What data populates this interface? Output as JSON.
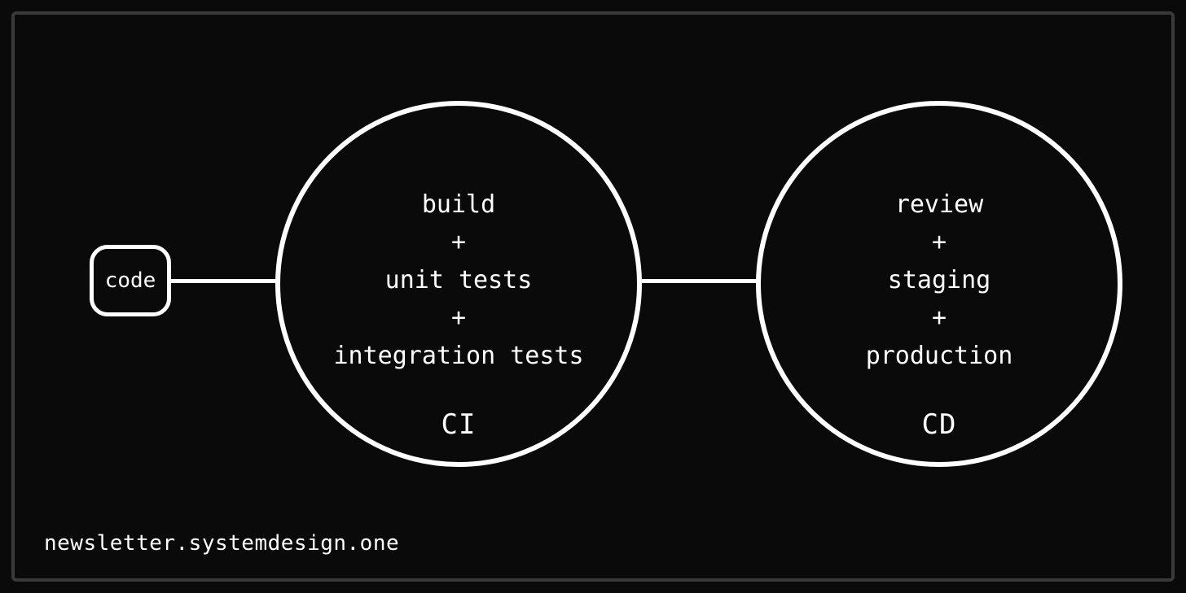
{
  "diagram": {
    "code_node": {
      "label": "code"
    },
    "ci_node": {
      "label": "CI",
      "lines": [
        "build",
        "+",
        "unit tests",
        "+",
        "integration tests"
      ]
    },
    "cd_node": {
      "label": "CD",
      "lines": [
        "review",
        "+",
        "staging",
        "+",
        "production"
      ]
    }
  },
  "attribution": "newsletter.systemdesign.one"
}
